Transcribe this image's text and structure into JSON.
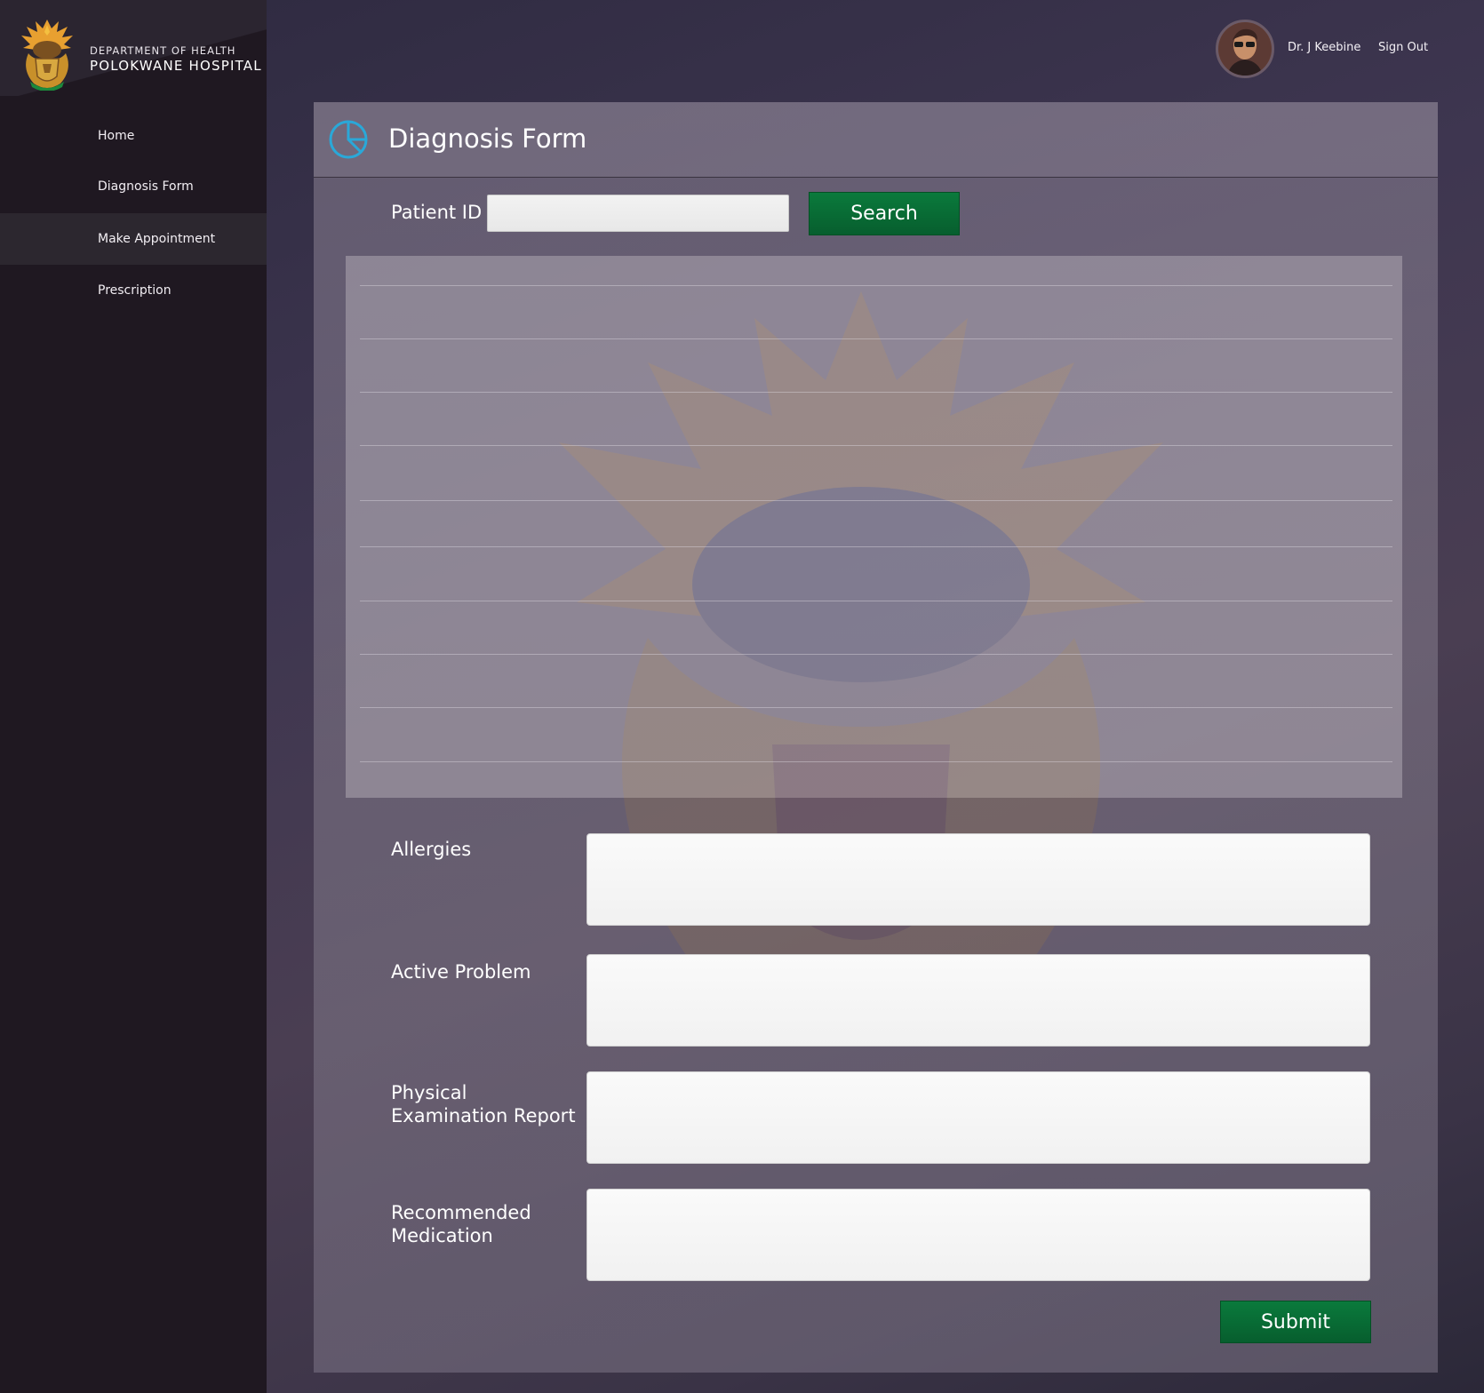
{
  "brand": {
    "department": "DEPARTMENT OF HEALTH",
    "hospital": "POLOKWANE HOSPITAL"
  },
  "sidebar": {
    "items": [
      {
        "label": "Home",
        "active": false
      },
      {
        "label": "Diagnosis Form",
        "active": false
      },
      {
        "label": "Make Appointment",
        "active": true
      },
      {
        "label": "Prescription",
        "active": false
      }
    ]
  },
  "header": {
    "user_name": "Dr. J Keebine",
    "sign_out": "Sign Out"
  },
  "form": {
    "title": "Diagnosis Form",
    "patient_id_label": "Patient ID",
    "patient_id_value": "",
    "search_label": "Search",
    "allergies_label": "Allergies",
    "active_problem_label": "Active Problem",
    "physical_exam_label": "Physical Examination Report",
    "recommended_med_label": "Recommended Medication",
    "submit_label": "Submit"
  },
  "colors": {
    "accent_green": "#0a7a3c",
    "icon_blue": "#2aa8d8",
    "sidebar_bg": "#1f1821"
  }
}
